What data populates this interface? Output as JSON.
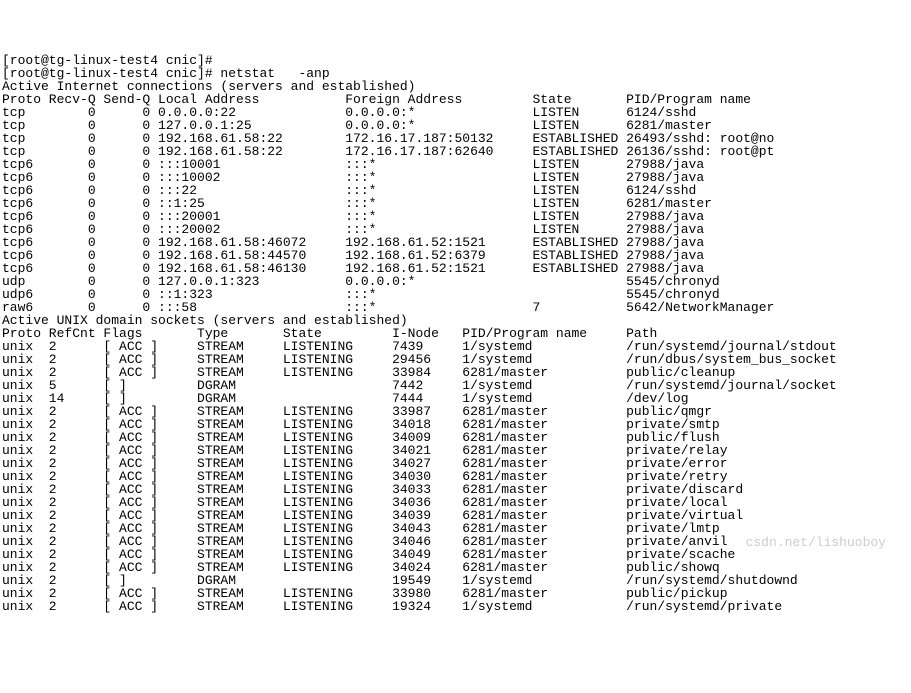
{
  "prompt1": "[root@tg-linux-test4 cnic]#",
  "prompt2": "[root@tg-linux-test4 cnic]# netstat   -anp",
  "header1": "Active Internet connections (servers and established)",
  "cols1": "Proto Recv-Q Send-Q Local Address           Foreign Address         State       PID/Program name",
  "net": [
    "tcp        0      0 0.0.0.0:22              0.0.0.0:*               LISTEN      6124/sshd",
    "tcp        0      0 127.0.0.1:25            0.0.0.0:*               LISTEN      6281/master",
    "tcp        0      0 192.168.61.58:22        172.16.17.187:50132     ESTABLISHED 26493/sshd: root@no",
    "tcp        0      0 192.168.61.58:22        172.16.17.187:62640     ESTABLISHED 26136/sshd: root@pt",
    "tcp6       0      0 :::10001                :::*                    LISTEN      27988/java",
    "tcp6       0      0 :::10002                :::*                    LISTEN      27988/java",
    "tcp6       0      0 :::22                   :::*                    LISTEN      6124/sshd",
    "tcp6       0      0 ::1:25                  :::*                    LISTEN      6281/master",
    "tcp6       0      0 :::20001                :::*                    LISTEN      27988/java",
    "tcp6       0      0 :::20002                :::*                    LISTEN      27988/java",
    "tcp6       0      0 192.168.61.58:46072     192.168.61.52:1521      ESTABLISHED 27988/java",
    "tcp6       0      0 192.168.61.58:44570     192.168.61.52:6379      ESTABLISHED 27988/java",
    "tcp6       0      0 192.168.61.58:46130     192.168.61.52:1521      ESTABLISHED 27988/java",
    "udp        0      0 127.0.0.1:323           0.0.0.0:*                           5545/chronyd",
    "udp6       0      0 ::1:323                 :::*                                5545/chronyd",
    "raw6       0      0 :::58                   :::*                    7           5642/NetworkManager"
  ],
  "header2": "Active UNIX domain sockets (servers and established)",
  "cols2": "Proto RefCnt Flags       Type       State         I-Node   PID/Program name     Path",
  "unix": [
    "unix  2      [ ACC ]     STREAM     LISTENING     7439     1/systemd            /run/systemd/journal/stdout",
    "unix  2      [ ACC ]     STREAM     LISTENING     29456    1/systemd            /run/dbus/system_bus_socket",
    "unix  2      [ ACC ]     STREAM     LISTENING     33984    6281/master          public/cleanup",
    "unix  5      [ ]         DGRAM                    7442     1/systemd            /run/systemd/journal/socket",
    "unix  14     [ ]         DGRAM                    7444     1/systemd            /dev/log",
    "unix  2      [ ACC ]     STREAM     LISTENING     33987    6281/master          public/qmgr",
    "unix  2      [ ACC ]     STREAM     LISTENING     34018    6281/master          private/smtp",
    "unix  2      [ ACC ]     STREAM     LISTENING     34009    6281/master          public/flush",
    "unix  2      [ ACC ]     STREAM     LISTENING     34021    6281/master          private/relay",
    "unix  2      [ ACC ]     STREAM     LISTENING     34027    6281/master          private/error",
    "unix  2      [ ACC ]     STREAM     LISTENING     34030    6281/master          private/retry",
    "unix  2      [ ACC ]     STREAM     LISTENING     34033    6281/master          private/discard",
    "unix  2      [ ACC ]     STREAM     LISTENING     34036    6281/master          private/local",
    "unix  2      [ ACC ]     STREAM     LISTENING     34039    6281/master          private/virtual",
    "unix  2      [ ACC ]     STREAM     LISTENING     34043    6281/master          private/lmtp",
    "unix  2      [ ACC ]     STREAM     LISTENING     34046    6281/master          private/anvil",
    "unix  2      [ ACC ]     STREAM     LISTENING     34049    6281/master          private/scache",
    "unix  2      [ ACC ]     STREAM     LISTENING     34024    6281/master          public/showq",
    "unix  2      [ ]         DGRAM                    19549    1/systemd            /run/systemd/shutdownd",
    "unix  2      [ ACC ]     STREAM     LISTENING     33980    6281/master          public/pickup",
    "unix  2      [ ACC ]     STREAM     LISTENING     19324    1/systemd            /run/systemd/private"
  ],
  "watermark": "csdn.net/lishuoboy"
}
